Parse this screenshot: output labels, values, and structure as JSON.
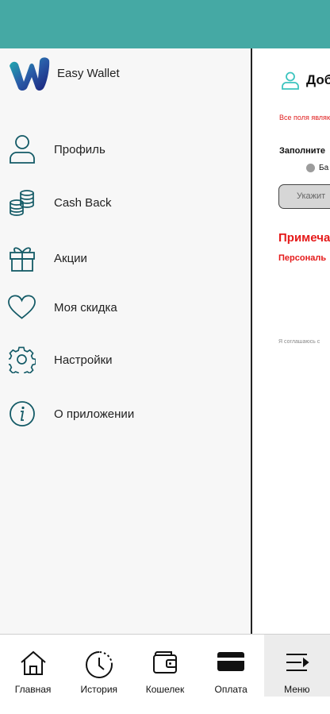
{
  "app": {
    "brand_name": "Easy Wallet",
    "accent_color": "#45a9a4",
    "icon_color": "#135a66"
  },
  "drawer": {
    "items": [
      {
        "label": "Профиль",
        "icon": "user-icon"
      },
      {
        "label": "Cash Back",
        "icon": "coins-icon"
      },
      {
        "label": "Акции",
        "icon": "gift-icon"
      },
      {
        "label": "Моя скидка",
        "icon": "heart-icon"
      },
      {
        "label": "Настройки",
        "icon": "gear-icon"
      },
      {
        "label": "О приложении",
        "icon": "info-icon"
      }
    ]
  },
  "background_page": {
    "title": "Доб",
    "required_note": "Все поля являю",
    "fill_label": "Заполните",
    "radio_label": "Ба",
    "input_placeholder": "Укажит",
    "note_heading": "Примеча",
    "personal_label": "Персональ",
    "agree_text": "Я соглашаюсь с"
  },
  "bottom_nav": {
    "tabs": [
      {
        "label": "Главная",
        "icon": "home-icon"
      },
      {
        "label": "История",
        "icon": "clock-history-icon"
      },
      {
        "label": "Кошелек",
        "icon": "wallet-icon"
      },
      {
        "label": "Оплата",
        "icon": "card-icon"
      },
      {
        "label": "Меню",
        "icon": "menu-icon",
        "active": true
      }
    ]
  }
}
